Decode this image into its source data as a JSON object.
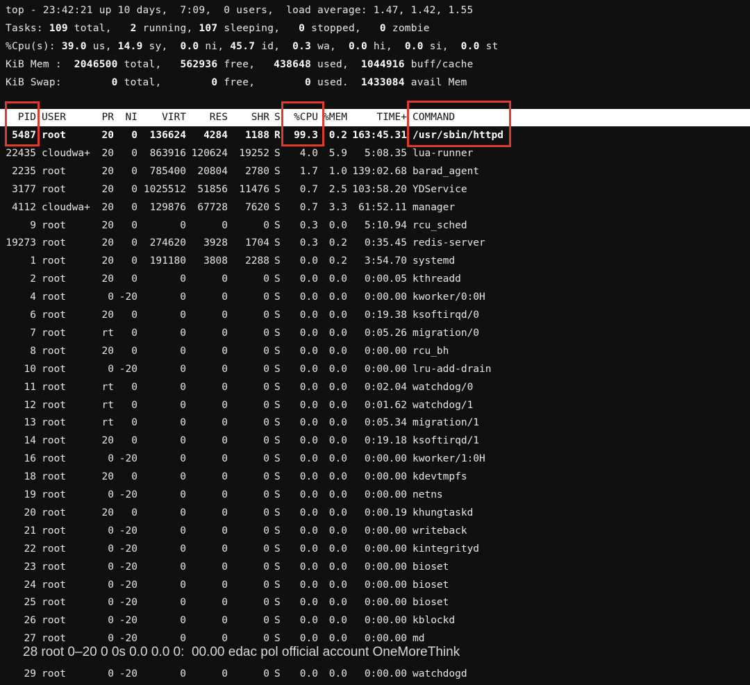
{
  "summary": {
    "top": "top - 23:42:21 up 10 days,  7:09,  0 users,  load average: 1.47, 1.42, 1.55",
    "tasks_label": "Tasks: ",
    "tasks_total": "109",
    "tasks_total_label": " total,   ",
    "tasks_running": "2",
    "tasks_running_label": " running, ",
    "tasks_sleeping": "107",
    "tasks_sleeping_label": " sleeping,   ",
    "tasks_stopped": "0",
    "tasks_stopped_label": " stopped,   ",
    "tasks_zombie": "0",
    "tasks_zombie_label": " zombie",
    "cpu_label": "%Cpu(s): ",
    "cpu_us": "39.0",
    "cpu_us_label": " us, ",
    "cpu_sy": "14.9",
    "cpu_sy_label": " sy,  ",
    "cpu_ni": "0.0",
    "cpu_ni_label": " ni, ",
    "cpu_id": "45.7",
    "cpu_id_label": " id,  ",
    "cpu_wa": "0.3",
    "cpu_wa_label": " wa,  ",
    "cpu_hi": "0.0",
    "cpu_hi_label": " hi,  ",
    "cpu_si": "0.0",
    "cpu_si_label": " si,  ",
    "cpu_st": "0.0",
    "cpu_st_label": " st",
    "mem_label": "KiB Mem :  ",
    "mem_total": "2046500",
    "mem_total_label": " total,   ",
    "mem_free": "562936",
    "mem_free_label": " free,   ",
    "mem_used": "438648",
    "mem_used_label": " used,  ",
    "mem_cache": "1044916",
    "mem_cache_label": " buff/cache",
    "swap_label": "KiB Swap:        ",
    "swap_total": "0",
    "swap_total_label": " total,        ",
    "swap_free": "0",
    "swap_free_label": " free,        ",
    "swap_used": "0",
    "swap_used_label": " used.  ",
    "swap_avail": "1433084",
    "swap_avail_label": " avail Mem"
  },
  "table": {
    "headers": {
      "pid": "PID",
      "user": "USER",
      "pr": "PR",
      "ni": "NI",
      "virt": "VIRT",
      "res": "RES",
      "shr": "SHR",
      "s": "S",
      "cpu": "%CPU",
      "mem": "%MEM",
      "time": "TIME+",
      "command": "COMMAND"
    },
    "rows": [
      {
        "pid": "5487",
        "user": "root",
        "pr": "20",
        "ni": "0",
        "virt": "136624",
        "res": "4284",
        "shr": "1188",
        "s": "R",
        "cpu": "99.3",
        "mem": "0.2",
        "time": "163:45.31",
        "command": "/usr/sbin/httpd"
      },
      {
        "pid": "22435",
        "user": "cloudwa+",
        "pr": "20",
        "ni": "0",
        "virt": "863916",
        "res": "120624",
        "shr": "19252",
        "s": "S",
        "cpu": "4.0",
        "mem": "5.9",
        "time": "5:08.35",
        "command": "lua-runner"
      },
      {
        "pid": "2235",
        "user": "root",
        "pr": "20",
        "ni": "0",
        "virt": "785400",
        "res": "20804",
        "shr": "2780",
        "s": "S",
        "cpu": "1.7",
        "mem": "1.0",
        "time": "139:02.68",
        "command": "barad_agent"
      },
      {
        "pid": "3177",
        "user": "root",
        "pr": "20",
        "ni": "0",
        "virt": "1025512",
        "res": "51856",
        "shr": "11476",
        "s": "S",
        "cpu": "0.7",
        "mem": "2.5",
        "time": "103:58.20",
        "command": "YDService"
      },
      {
        "pid": "4112",
        "user": "cloudwa+",
        "pr": "20",
        "ni": "0",
        "virt": "129876",
        "res": "67728",
        "shr": "7620",
        "s": "S",
        "cpu": "0.7",
        "mem": "3.3",
        "time": "61:52.11",
        "command": "manager"
      },
      {
        "pid": "9",
        "user": "root",
        "pr": "20",
        "ni": "0",
        "virt": "0",
        "res": "0",
        "shr": "0",
        "s": "S",
        "cpu": "0.3",
        "mem": "0.0",
        "time": "5:10.94",
        "command": "rcu_sched"
      },
      {
        "pid": "19273",
        "user": "root",
        "pr": "20",
        "ni": "0",
        "virt": "274620",
        "res": "3928",
        "shr": "1704",
        "s": "S",
        "cpu": "0.3",
        "mem": "0.2",
        "time": "0:35.45",
        "command": "redis-server"
      },
      {
        "pid": "1",
        "user": "root",
        "pr": "20",
        "ni": "0",
        "virt": "191180",
        "res": "3808",
        "shr": "2288",
        "s": "S",
        "cpu": "0.0",
        "mem": "0.2",
        "time": "3:54.70",
        "command": "systemd"
      },
      {
        "pid": "2",
        "user": "root",
        "pr": "20",
        "ni": "0",
        "virt": "0",
        "res": "0",
        "shr": "0",
        "s": "S",
        "cpu": "0.0",
        "mem": "0.0",
        "time": "0:00.05",
        "command": "kthreadd"
      },
      {
        "pid": "4",
        "user": "root",
        "pr": "0",
        "ni": "-20",
        "virt": "0",
        "res": "0",
        "shr": "0",
        "s": "S",
        "cpu": "0.0",
        "mem": "0.0",
        "time": "0:00.00",
        "command": "kworker/0:0H"
      },
      {
        "pid": "6",
        "user": "root",
        "pr": "20",
        "ni": "0",
        "virt": "0",
        "res": "0",
        "shr": "0",
        "s": "S",
        "cpu": "0.0",
        "mem": "0.0",
        "time": "0:19.38",
        "command": "ksoftirqd/0"
      },
      {
        "pid": "7",
        "user": "root",
        "pr": "rt",
        "ni": "0",
        "virt": "0",
        "res": "0",
        "shr": "0",
        "s": "S",
        "cpu": "0.0",
        "mem": "0.0",
        "time": "0:05.26",
        "command": "migration/0"
      },
      {
        "pid": "8",
        "user": "root",
        "pr": "20",
        "ni": "0",
        "virt": "0",
        "res": "0",
        "shr": "0",
        "s": "S",
        "cpu": "0.0",
        "mem": "0.0",
        "time": "0:00.00",
        "command": "rcu_bh"
      },
      {
        "pid": "10",
        "user": "root",
        "pr": "0",
        "ni": "-20",
        "virt": "0",
        "res": "0",
        "shr": "0",
        "s": "S",
        "cpu": "0.0",
        "mem": "0.0",
        "time": "0:00.00",
        "command": "lru-add-drain"
      },
      {
        "pid": "11",
        "user": "root",
        "pr": "rt",
        "ni": "0",
        "virt": "0",
        "res": "0",
        "shr": "0",
        "s": "S",
        "cpu": "0.0",
        "mem": "0.0",
        "time": "0:02.04",
        "command": "watchdog/0"
      },
      {
        "pid": "12",
        "user": "root",
        "pr": "rt",
        "ni": "0",
        "virt": "0",
        "res": "0",
        "shr": "0",
        "s": "S",
        "cpu": "0.0",
        "mem": "0.0",
        "time": "0:01.62",
        "command": "watchdog/1"
      },
      {
        "pid": "13",
        "user": "root",
        "pr": "rt",
        "ni": "0",
        "virt": "0",
        "res": "0",
        "shr": "0",
        "s": "S",
        "cpu": "0.0",
        "mem": "0.0",
        "time": "0:05.34",
        "command": "migration/1"
      },
      {
        "pid": "14",
        "user": "root",
        "pr": "20",
        "ni": "0",
        "virt": "0",
        "res": "0",
        "shr": "0",
        "s": "S",
        "cpu": "0.0",
        "mem": "0.0",
        "time": "0:19.18",
        "command": "ksoftirqd/1"
      },
      {
        "pid": "16",
        "user": "root",
        "pr": "0",
        "ni": "-20",
        "virt": "0",
        "res": "0",
        "shr": "0",
        "s": "S",
        "cpu": "0.0",
        "mem": "0.0",
        "time": "0:00.00",
        "command": "kworker/1:0H"
      },
      {
        "pid": "18",
        "user": "root",
        "pr": "20",
        "ni": "0",
        "virt": "0",
        "res": "0",
        "shr": "0",
        "s": "S",
        "cpu": "0.0",
        "mem": "0.0",
        "time": "0:00.00",
        "command": "kdevtmpfs"
      },
      {
        "pid": "19",
        "user": "root",
        "pr": "0",
        "ni": "-20",
        "virt": "0",
        "res": "0",
        "shr": "0",
        "s": "S",
        "cpu": "0.0",
        "mem": "0.0",
        "time": "0:00.00",
        "command": "netns"
      },
      {
        "pid": "20",
        "user": "root",
        "pr": "20",
        "ni": "0",
        "virt": "0",
        "res": "0",
        "shr": "0",
        "s": "S",
        "cpu": "0.0",
        "mem": "0.0",
        "time": "0:00.19",
        "command": "khungtaskd"
      },
      {
        "pid": "21",
        "user": "root",
        "pr": "0",
        "ni": "-20",
        "virt": "0",
        "res": "0",
        "shr": "0",
        "s": "S",
        "cpu": "0.0",
        "mem": "0.0",
        "time": "0:00.00",
        "command": "writeback"
      },
      {
        "pid": "22",
        "user": "root",
        "pr": "0",
        "ni": "-20",
        "virt": "0",
        "res": "0",
        "shr": "0",
        "s": "S",
        "cpu": "0.0",
        "mem": "0.0",
        "time": "0:00.00",
        "command": "kintegrityd"
      },
      {
        "pid": "23",
        "user": "root",
        "pr": "0",
        "ni": "-20",
        "virt": "0",
        "res": "0",
        "shr": "0",
        "s": "S",
        "cpu": "0.0",
        "mem": "0.0",
        "time": "0:00.00",
        "command": "bioset"
      },
      {
        "pid": "24",
        "user": "root",
        "pr": "0",
        "ni": "-20",
        "virt": "0",
        "res": "0",
        "shr": "0",
        "s": "S",
        "cpu": "0.0",
        "mem": "0.0",
        "time": "0:00.00",
        "command": "bioset"
      },
      {
        "pid": "25",
        "user": "root",
        "pr": "0",
        "ni": "-20",
        "virt": "0",
        "res": "0",
        "shr": "0",
        "s": "S",
        "cpu": "0.0",
        "mem": "0.0",
        "time": "0:00.00",
        "command": "bioset"
      },
      {
        "pid": "26",
        "user": "root",
        "pr": "0",
        "ni": "-20",
        "virt": "0",
        "res": "0",
        "shr": "0",
        "s": "S",
        "cpu": "0.0",
        "mem": "0.0",
        "time": "0:00.00",
        "command": "kblockd"
      },
      {
        "pid": "27",
        "user": "root",
        "pr": "0",
        "ni": "-20",
        "virt": "0",
        "res": "0",
        "shr": "0",
        "s": "S",
        "cpu": "0.0",
        "mem": "0.0",
        "time": "0:00.00",
        "command": "md"
      },
      {
        "pid": "29",
        "user": "root",
        "pr": "0",
        "ni": "-20",
        "virt": "0",
        "res": "0",
        "shr": "0",
        "s": "S",
        "cpu": "0.0",
        "mem": "0.0",
        "time": "0:00.00",
        "command": "watchdogd"
      }
    ]
  },
  "watermark": "28 root 0–20 0 0s 0.0 0.0 0:  00.00 edac pol official account OneMoreThink",
  "colors": {
    "background": "#101010",
    "text": "#e6e6e6",
    "header_bar": "#ffffff",
    "highlight_box": "#e23a2c"
  }
}
